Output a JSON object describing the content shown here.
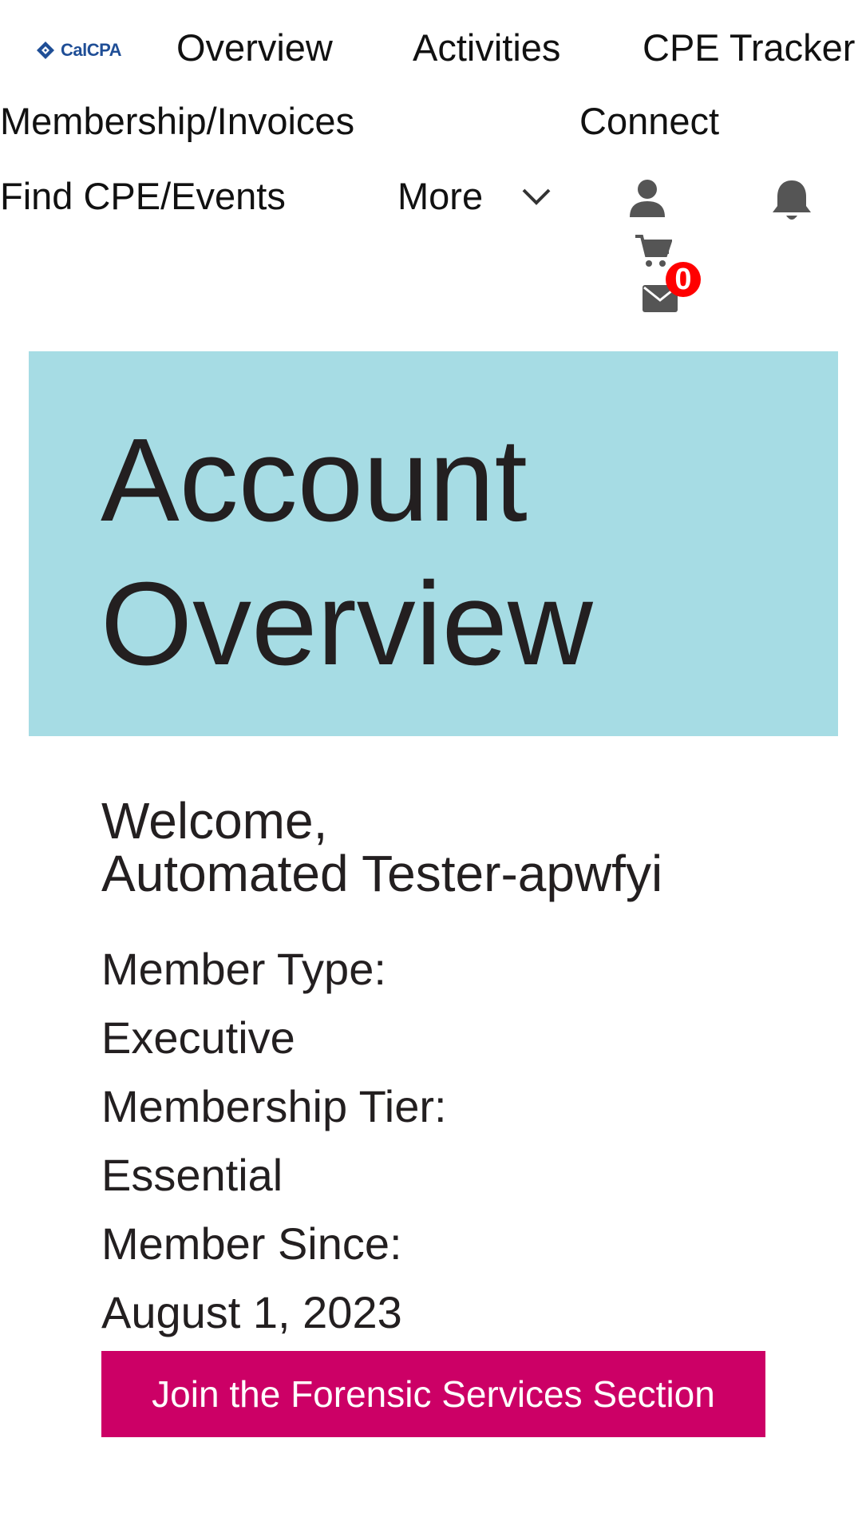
{
  "logo": {
    "text": "CalCPA",
    "brand_color": "#1f4e96"
  },
  "nav": {
    "overview": "Overview",
    "activities": "Activities",
    "cpe_tracker": "CPE Tracker",
    "membership_invoices": "Membership/Invoices",
    "connect": "Connect",
    "find_cpe_events": "Find CPE/Events",
    "more": "More"
  },
  "icons": {
    "user": "user-icon",
    "bell": "bell-icon",
    "cart": "cart-icon",
    "mail": "mail-icon",
    "chevron": "chevron-down-icon"
  },
  "notifications": {
    "count": "0",
    "badge_color": "#ff0000"
  },
  "hero": {
    "title": "Account Overview",
    "background": "#a6dce4"
  },
  "account": {
    "welcome_line1": "Welcome,",
    "welcome_line2": "Automated Tester-apwfyi",
    "member_type_label": "Member Type:",
    "member_type_value": "Executive",
    "tier_label": "Membership Tier:",
    "tier_value": "Essential",
    "since_label": "Member Since:",
    "since_value": "August 1, 2023"
  },
  "cta": {
    "label": "Join the Forensic Services Section",
    "color": "#cc0066"
  }
}
